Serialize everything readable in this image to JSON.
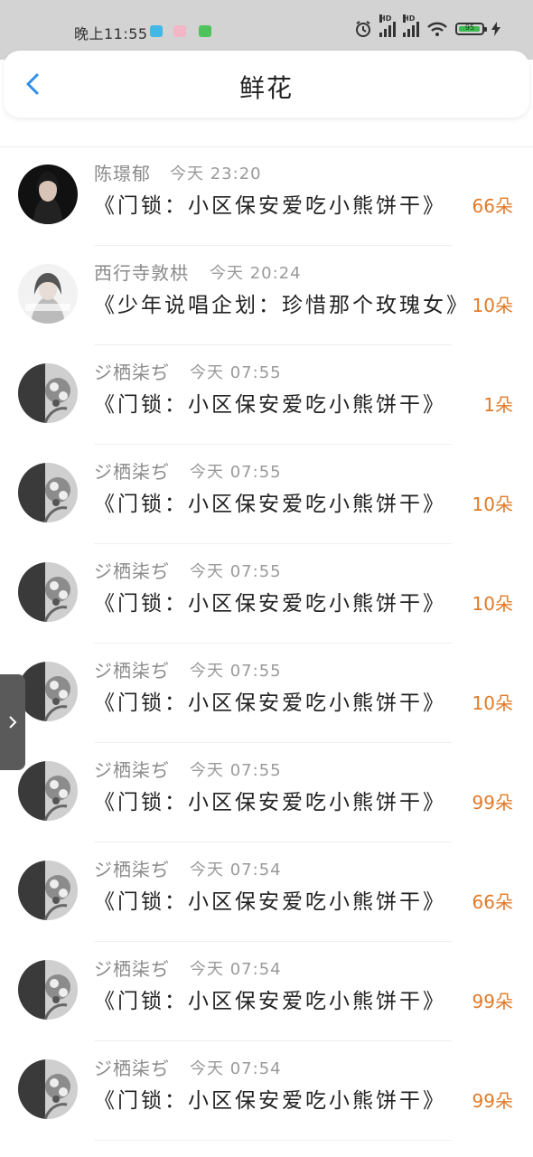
{
  "status_bar": {
    "time": "晚上11:55",
    "apps": [
      {
        "icon": "app-blue-icon",
        "color": "#41b8e6"
      },
      {
        "icon": "app-pink-icon",
        "color": "#f2b6c6"
      },
      {
        "icon": "app-green-icon",
        "color": "#4dc35b"
      }
    ],
    "battery": "95",
    "network": "HD"
  },
  "header": {
    "title": "鲜花",
    "back_icon": "back-arrow-icon",
    "accent": "#2e8de8"
  },
  "side_tab_icon": "chevron-right-icon",
  "items": [
    {
      "name": "陈璟郁",
      "time": "今天 23:20",
      "text": "《门锁：小区保安爱吃小熊饼干》",
      "amount": "66朵",
      "avatar": "avatar-woman-dark"
    },
    {
      "name": "西行寺敦栱",
      "time": "今天 20:24",
      "text": "《少年说唱企划：珍惜那个玫瑰女》",
      "amount": "10朵",
      "avatar": "avatar-woman-light"
    },
    {
      "name": "ジ栖柒ぢ",
      "time": "今天 07:55",
      "text": "《门锁：小区保安爱吃小熊饼干》",
      "amount": "1朵",
      "avatar": "avatar-floral"
    },
    {
      "name": "ジ栖柒ぢ",
      "time": "今天 07:55",
      "text": "《门锁：小区保安爱吃小熊饼干》",
      "amount": "10朵",
      "avatar": "avatar-floral"
    },
    {
      "name": "ジ栖柒ぢ",
      "time": "今天 07:55",
      "text": "《门锁：小区保安爱吃小熊饼干》",
      "amount": "10朵",
      "avatar": "avatar-floral"
    },
    {
      "name": "ジ栖柒ぢ",
      "time": "今天 07:55",
      "text": "《门锁：小区保安爱吃小熊饼干》",
      "amount": "10朵",
      "avatar": "avatar-floral"
    },
    {
      "name": "ジ栖柒ぢ",
      "time": "今天 07:55",
      "text": "《门锁：小区保安爱吃小熊饼干》",
      "amount": "99朵",
      "avatar": "avatar-floral"
    },
    {
      "name": "ジ栖柒ぢ",
      "time": "今天 07:54",
      "text": "《门锁：小区保安爱吃小熊饼干》",
      "amount": "66朵",
      "avatar": "avatar-floral"
    },
    {
      "name": "ジ栖柒ぢ",
      "time": "今天 07:54",
      "text": "《门锁：小区保安爱吃小熊饼干》",
      "amount": "99朵",
      "avatar": "avatar-floral"
    },
    {
      "name": "ジ栖柒ぢ",
      "time": "今天 07:54",
      "text": "《门锁：小区保安爱吃小熊饼干》",
      "amount": "99朵",
      "avatar": "avatar-floral"
    }
  ]
}
